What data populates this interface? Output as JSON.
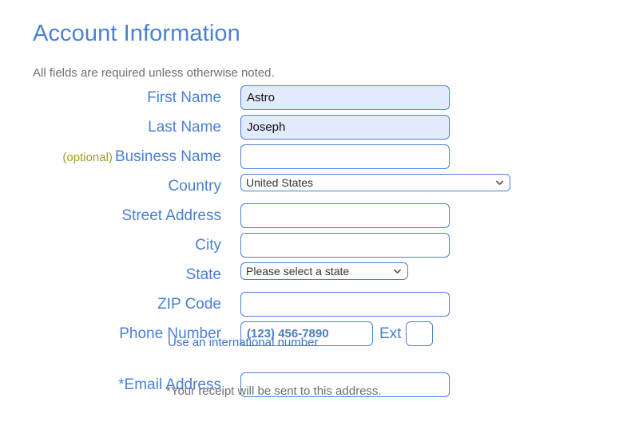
{
  "heading": {
    "title": "Account Information",
    "subtitle": "All fields are required unless otherwise noted."
  },
  "colors": {
    "label_blue": "#4a80d3",
    "heading_blue": "#4a80d3",
    "optional_olive": "#9e9e22",
    "muted_gray": "#6e6e6e",
    "autofill_background": "#e3eafd",
    "input_border": "#4a80d3"
  },
  "fields": {
    "first_name": {
      "label": "First Name",
      "value": "Astro",
      "placeholder": "",
      "autofilled": true
    },
    "last_name": {
      "label": "Last Name",
      "value": "Joseph",
      "placeholder": "",
      "autofilled": true
    },
    "business_name": {
      "label": "Business Name",
      "optional_tag": "(optional)",
      "value": "",
      "placeholder": "",
      "autofilled": false
    },
    "country": {
      "label": "Country",
      "selected": "United States",
      "options": [
        "United States"
      ]
    },
    "street_address": {
      "label": "Street Address",
      "value": "",
      "placeholder": ""
    },
    "city": {
      "label": "City",
      "value": "",
      "placeholder": ""
    },
    "state": {
      "label": "State",
      "selected": "Please select a state",
      "options": [
        "Please select a state"
      ]
    },
    "zip_code": {
      "label": "ZIP Code",
      "value": "",
      "placeholder": ""
    },
    "phone_number": {
      "label": "Phone Number",
      "value": "",
      "placeholder": "(123) 456-7890",
      "ext_label": "Ext",
      "ext_value": "",
      "helper_link": "Use an international number"
    },
    "email_address": {
      "label": "*Email Address",
      "value": "",
      "placeholder": "",
      "footnote": "*Your receipt will be sent to this address."
    }
  },
  "icons": {
    "chevron_down": "chevron-down-icon"
  }
}
